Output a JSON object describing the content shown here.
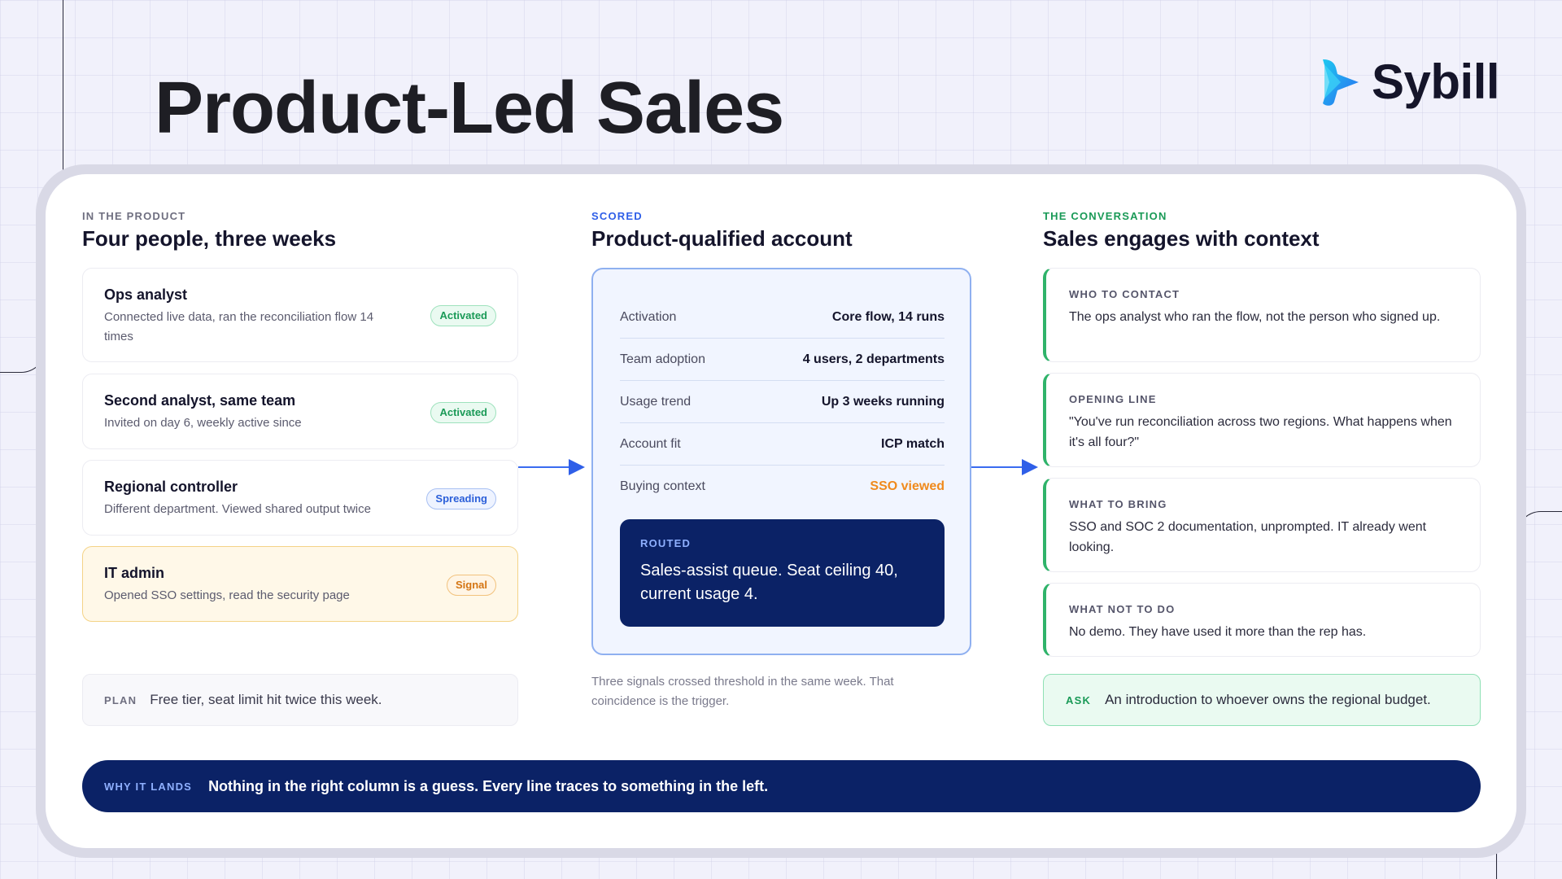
{
  "page": {
    "title": "Product-Led Sales",
    "brand": "Sybill"
  },
  "left": {
    "eyebrow": "IN THE PRODUCT",
    "heading": "Four people, three weeks",
    "people": [
      {
        "name": "Ops analyst",
        "desc": "Connected live data, ran the reconciliation flow 14 times",
        "badge": "Activated"
      },
      {
        "name": "Second analyst, same team",
        "desc": "Invited on day 6, weekly active since",
        "badge": "Activated"
      },
      {
        "name": "Regional controller",
        "desc": "Different department. Viewed shared output twice",
        "badge": "Spreading"
      },
      {
        "name": "IT admin",
        "desc": "Opened SSO settings, read the security page",
        "badge": "Signal"
      }
    ],
    "plan": {
      "label": "PLAN",
      "text": "Free tier, seat limit hit twice this week."
    }
  },
  "middle": {
    "eyebrow": "SCORED",
    "heading": "Product-qualified account",
    "rows": [
      {
        "key": "Activation",
        "value": "Core flow, 14 runs"
      },
      {
        "key": "Team adoption",
        "value": "4 users, 2 departments"
      },
      {
        "key": "Usage trend",
        "value": "Up 3 weeks running"
      },
      {
        "key": "Account fit",
        "value": "ICP match"
      },
      {
        "key": "Buying context",
        "value": "SSO viewed"
      }
    ],
    "routed": {
      "label": "ROUTED",
      "text": "Sales-assist queue. Seat ceiling 40, current usage 4."
    },
    "caption": "Three signals crossed threshold in the same week. That coincidence is the trigger."
  },
  "right": {
    "eyebrow": "THE CONVERSATION",
    "heading": "Sales engages with context",
    "cards": [
      {
        "label": "WHO TO CONTACT",
        "text": "The ops analyst who ran the flow, not the person who signed up."
      },
      {
        "label": "OPENING LINE",
        "text": "\"You've run reconciliation across two regions. What happens when it's all four?\""
      },
      {
        "label": "WHAT TO BRING",
        "text": "SSO and SOC 2 documentation, unprompted. IT already went looking."
      },
      {
        "label": "WHAT NOT TO DO",
        "text": "No demo. They have used it more than the rep has."
      }
    ],
    "ask": {
      "label": "ASK",
      "text": "An introduction to whoever owns the regional budget."
    }
  },
  "why": {
    "label": "WHY IT LANDS",
    "text": "Nothing in the right column is a guess. Every line traces to something in the left."
  },
  "colors": {
    "navy": "#0b2266",
    "accent_blue": "#2f5fe8",
    "green": "#1a9a57",
    "orange": "#f08a1c",
    "eyebrow_gray": "#6f6f80"
  }
}
